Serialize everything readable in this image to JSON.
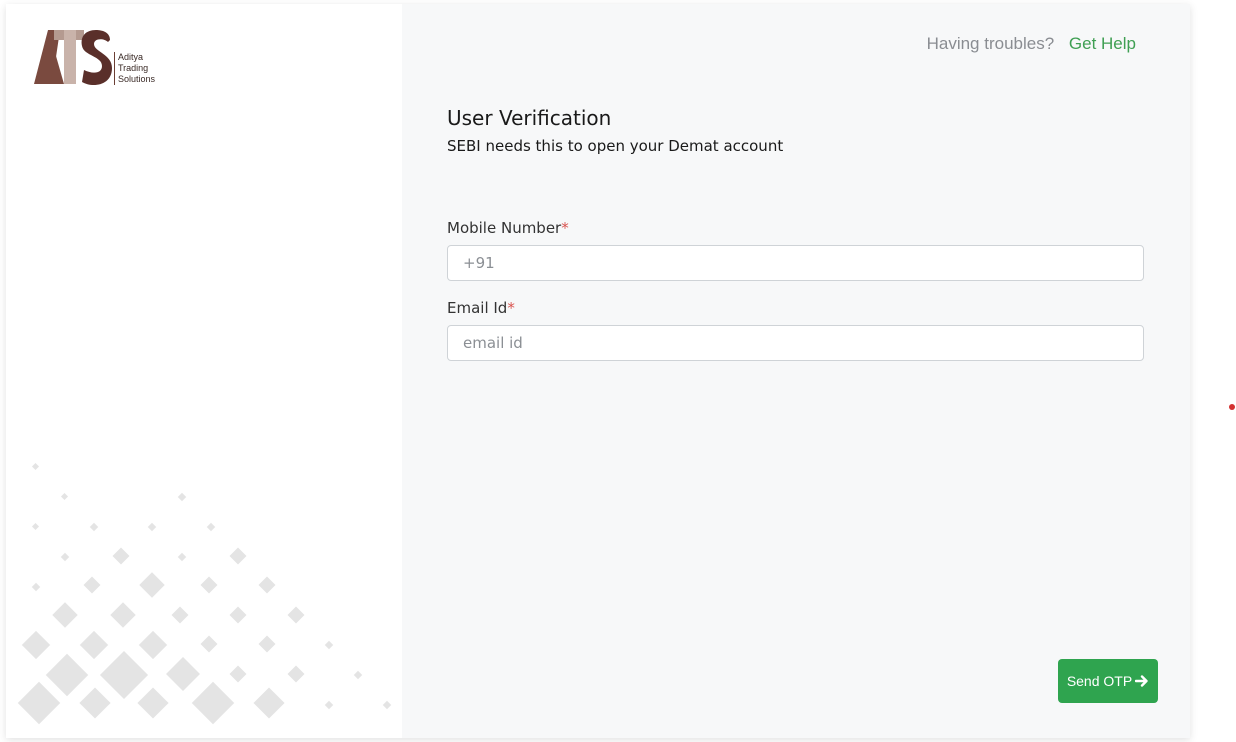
{
  "logo": {
    "letters": "ATS",
    "line1": "Aditya",
    "line2": "Trading",
    "line3": "Solutions"
  },
  "help": {
    "question": "Having troubles?",
    "link": "Get Help"
  },
  "heading": {
    "title": "User Verification",
    "subtitle": "SEBI needs this to open your Demat account"
  },
  "form": {
    "mobile": {
      "label": "Mobile Number",
      "required_mark": "*",
      "placeholder": "+91",
      "value": ""
    },
    "email": {
      "label": "Email Id",
      "required_mark": "*",
      "placeholder": "email id",
      "value": ""
    }
  },
  "actions": {
    "send_otp_label": "Send OTP",
    "send_otp_icon": "arrow-right-icon"
  },
  "colors": {
    "accent_green": "#2fa44f",
    "link_green": "#3f9f53",
    "logo_brown": "#7a4a3f",
    "required_red": "#d9534f",
    "panel_background": "#f7f8f9"
  }
}
